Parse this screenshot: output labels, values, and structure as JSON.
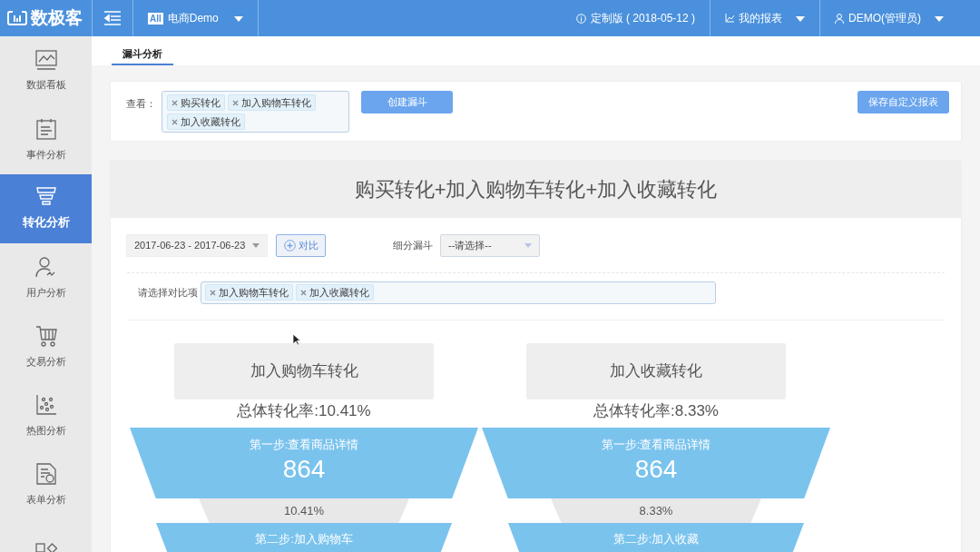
{
  "brand": {
    "name": "数极客"
  },
  "topbar": {
    "project_badge": "All",
    "project": "电商Demo",
    "version": "定制版 ( 2018-05-12 )",
    "reports": "我的报表",
    "user": "DEMO(管理员)"
  },
  "sidebar": {
    "items": [
      {
        "kind": "dashboard",
        "label": "数据看板",
        "selected": false
      },
      {
        "kind": "event",
        "label": "事件分析",
        "selected": false
      },
      {
        "kind": "funnel",
        "label": "转化分析",
        "selected": true
      },
      {
        "kind": "user",
        "label": "用户分析",
        "selected": false
      },
      {
        "kind": "cart",
        "label": "交易分析",
        "selected": false
      },
      {
        "kind": "heatmap",
        "label": "热图分析",
        "selected": false
      },
      {
        "kind": "form",
        "label": "表单分析",
        "selected": false
      },
      {
        "kind": "apps",
        "selected": false
      }
    ]
  },
  "tabs": [
    {
      "label": "漏斗分析",
      "selected": true
    }
  ],
  "filter": {
    "label": "查看：",
    "tags": [
      "购买转化",
      "加入购物车转化",
      "加入收藏转化"
    ],
    "create_button": "创建漏斗",
    "save_button": "保存自定义报表"
  },
  "report": {
    "title": "购买转化+加入购物车转化+加入收藏转化",
    "date_range": "2017-06-23 - 2017-06-23",
    "compare_button": "对比",
    "segment_label": "细分漏斗",
    "segment_placeholder": "--请选择--",
    "compare_label": "请选择对比项",
    "compare_tags": [
      "加入购物车转化",
      "加入收藏转化"
    ],
    "funnels": [
      {
        "title": "加入购物车转化",
        "overall": "总体转化率:10.41%",
        "steps": [
          {
            "label": "第一步:查看商品详情",
            "value": "864",
            "rate": "10.41%"
          },
          {
            "label": "第二步:加入购物车"
          }
        ]
      },
      {
        "title": "加入收藏转化",
        "overall": "总体转化率:8.33%",
        "steps": [
          {
            "label": "第一步:查看商品详情",
            "value": "864",
            "rate": "8.33%"
          },
          {
            "label": "第二步:加入收藏"
          }
        ]
      }
    ]
  }
}
